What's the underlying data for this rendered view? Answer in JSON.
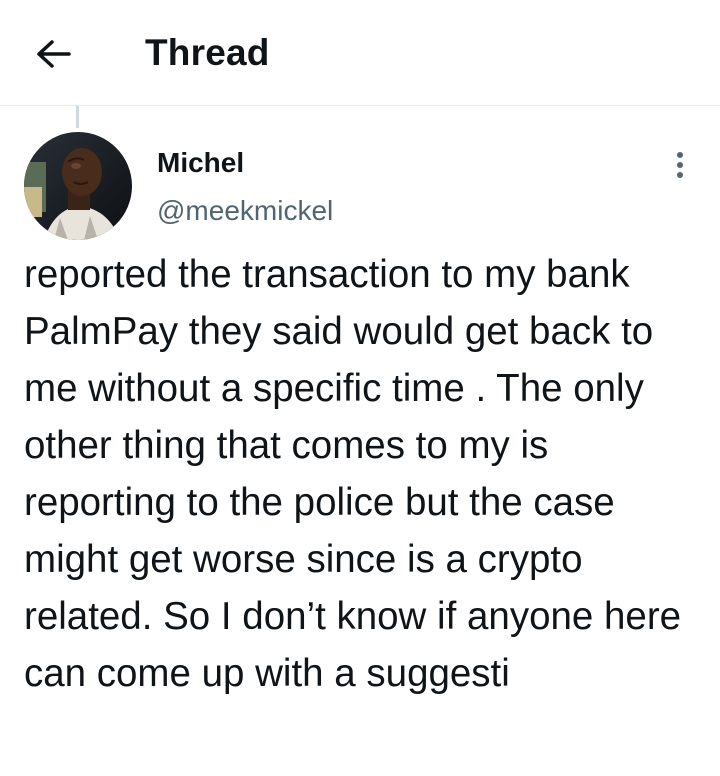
{
  "header": {
    "title": "Thread",
    "back_icon": "arrow-left-icon"
  },
  "tweet": {
    "author": {
      "name": "Michel",
      "handle": "@meekmickel"
    },
    "more_icon": "more-vertical-icon",
    "text": "reported the transaction to my bank PalmPay they said would get back to me without a specific time . The only other thing that comes to my is reporting to the police but the case might get worse since is a crypto related. So I don’t know if anyone here can come up with a suggesti"
  },
  "colors": {
    "text_primary": "#0f1419",
    "text_secondary": "#536471",
    "divider": "#e6ecf0",
    "thread_line": "#cfd9de"
  }
}
